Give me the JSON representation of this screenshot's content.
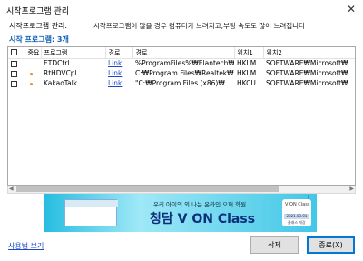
{
  "window": {
    "title": "시작프로그램 관리",
    "close_glyph": "✕"
  },
  "description": {
    "label": "시작프로그램 관리:",
    "text": "시작프로그램이 많을 경우 컴퓨터가 느려지고,부팅 속도도 많이 느려집니다"
  },
  "count_label": "시작 프로그램: 3개",
  "table": {
    "columns": [
      "중요",
      "프로그램",
      "경로",
      "경로",
      "위치1",
      "위치2"
    ],
    "rows": [
      {
        "checked": false,
        "important": false,
        "program": "ETDCtrl",
        "path_link": "Link",
        "path": "%ProgramFiles%₩Elantech₩...",
        "loc1": "HKLM",
        "loc2": "SOFTWARE₩Microsoft₩..."
      },
      {
        "checked": false,
        "important": true,
        "program": "RtHDVCpl",
        "path_link": "Link",
        "path": "C:₩Program Files₩Realtek₩...",
        "loc1": "HKLM",
        "loc2": "SOFTWARE₩Microsoft₩..."
      },
      {
        "checked": false,
        "important": true,
        "program": "KakaoTalk",
        "path_link": "Link",
        "path": "\"C:₩Program Files (x86)₩...",
        "loc1": "HKCU",
        "loc2": "SOFTWARE₩Microsoft₩..."
      }
    ]
  },
  "banner": {
    "line1": "우리 아이의 외 나는 온라인 오퍼 학원",
    "line2": "청담 V ON Class",
    "badge_logo": "V ON Class",
    "badge_date": "2021.03.01",
    "badge_sub": "클래스 개강",
    "info_icon": "i"
  },
  "footer": {
    "link": "사용법 보기",
    "delete_button": "삭제",
    "close_button": "종료(X)"
  },
  "colors": {
    "accent_text": "#0f5fb4",
    "link": "#1b48c8",
    "important_dot": "#e8941f"
  }
}
